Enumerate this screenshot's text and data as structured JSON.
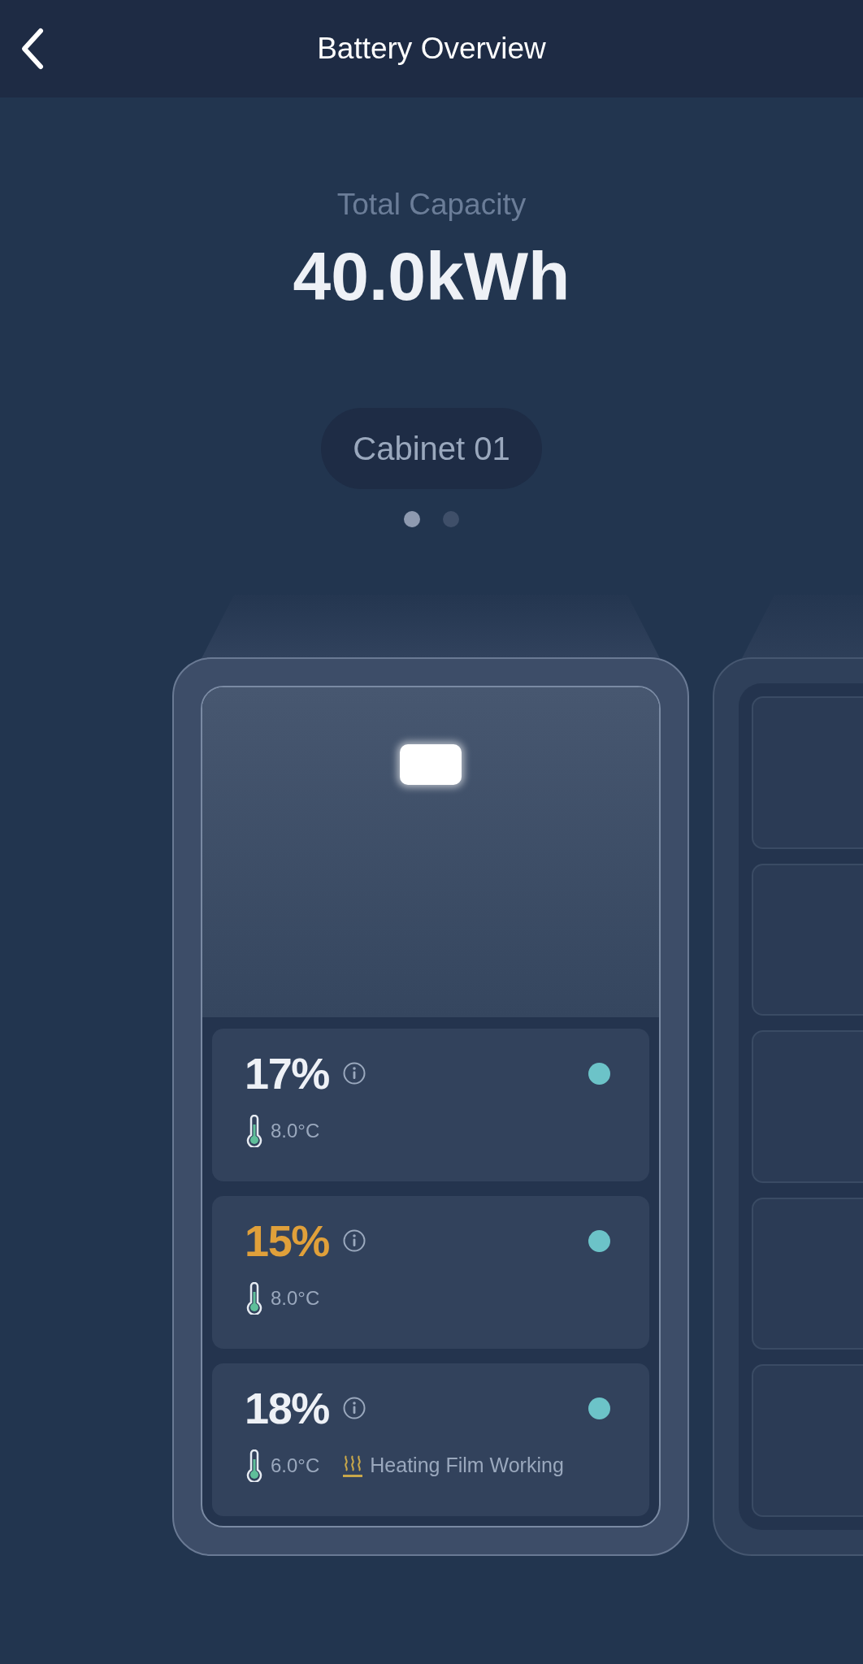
{
  "header": {
    "title": "Battery Overview"
  },
  "summary": {
    "label": "Total Capacity",
    "value": "40.0kWh"
  },
  "cabinet_tab": {
    "label": "Cabinet 01"
  },
  "pager": [
    {
      "selected": true
    },
    {
      "selected": false
    }
  ],
  "cabinets": [
    {
      "kind": "detailed",
      "indicator_on": true,
      "modules": [
        {
          "soc": "17%",
          "warning": false,
          "temperature": "8.0°C",
          "color": "#6cc3c8"
        },
        {
          "soc": "15%",
          "warning": true,
          "temperature": "8.0°C",
          "color": "#6cc3c8"
        },
        {
          "soc": "18%",
          "warning": false,
          "temperature": "6.0°C",
          "heating": "Heating Film Working",
          "color": "#6cc3c8"
        }
      ]
    },
    {
      "kind": "slots"
    }
  ]
}
